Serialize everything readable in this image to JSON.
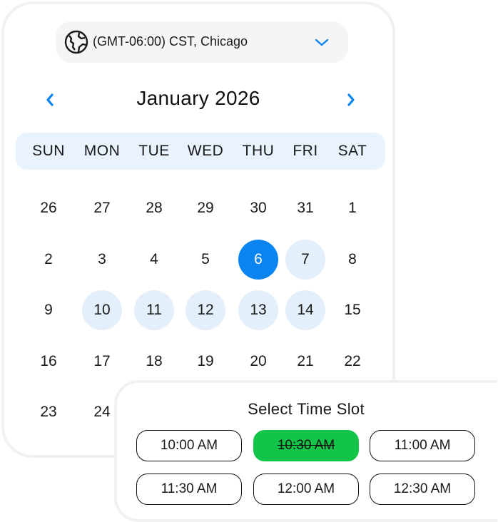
{
  "timezone": {
    "label": "(GMT-06:00) CST, Chicago",
    "icon": "globe-icon",
    "dropdown_icon": "chevron-down-icon"
  },
  "calendar": {
    "month_label": "January 2026",
    "prev_icon": "chevron-left-icon",
    "next_icon": "chevron-right-icon",
    "weekdays": [
      "SUN",
      "MON",
      "TUE",
      "WED",
      "THU",
      "FRI",
      "SAT"
    ],
    "weeks": [
      [
        "26",
        "27",
        "28",
        "29",
        "30",
        "31",
        "1"
      ],
      [
        "2",
        "3",
        "4",
        "5",
        "6",
        "7",
        "8"
      ],
      [
        "9",
        "10",
        "11",
        "12",
        "13",
        "14",
        "15"
      ],
      [
        "16",
        "17",
        "18",
        "19",
        "20",
        "21",
        "22"
      ],
      [
        "23",
        "24"
      ]
    ],
    "selected_day": "6",
    "available_days": [
      "7",
      "10",
      "11",
      "12",
      "13",
      "14"
    ],
    "colors": {
      "accent": "#0a84f0",
      "available_bg": "#e3effa",
      "weekday_bar_bg": "#e9f3fd"
    }
  },
  "time_slots": {
    "title": "Select Time Slot",
    "slots": [
      {
        "label": "10:00 AM",
        "booked": false
      },
      {
        "label": "10:30 AM",
        "booked": true
      },
      {
        "label": "11:00 AM",
        "booked": false
      },
      {
        "label": "11:30 AM",
        "booked": false
      },
      {
        "label": "12:00 AM",
        "booked": false
      },
      {
        "label": "12:30 AM",
        "booked": false
      }
    ],
    "booked_color": "#12c447"
  }
}
